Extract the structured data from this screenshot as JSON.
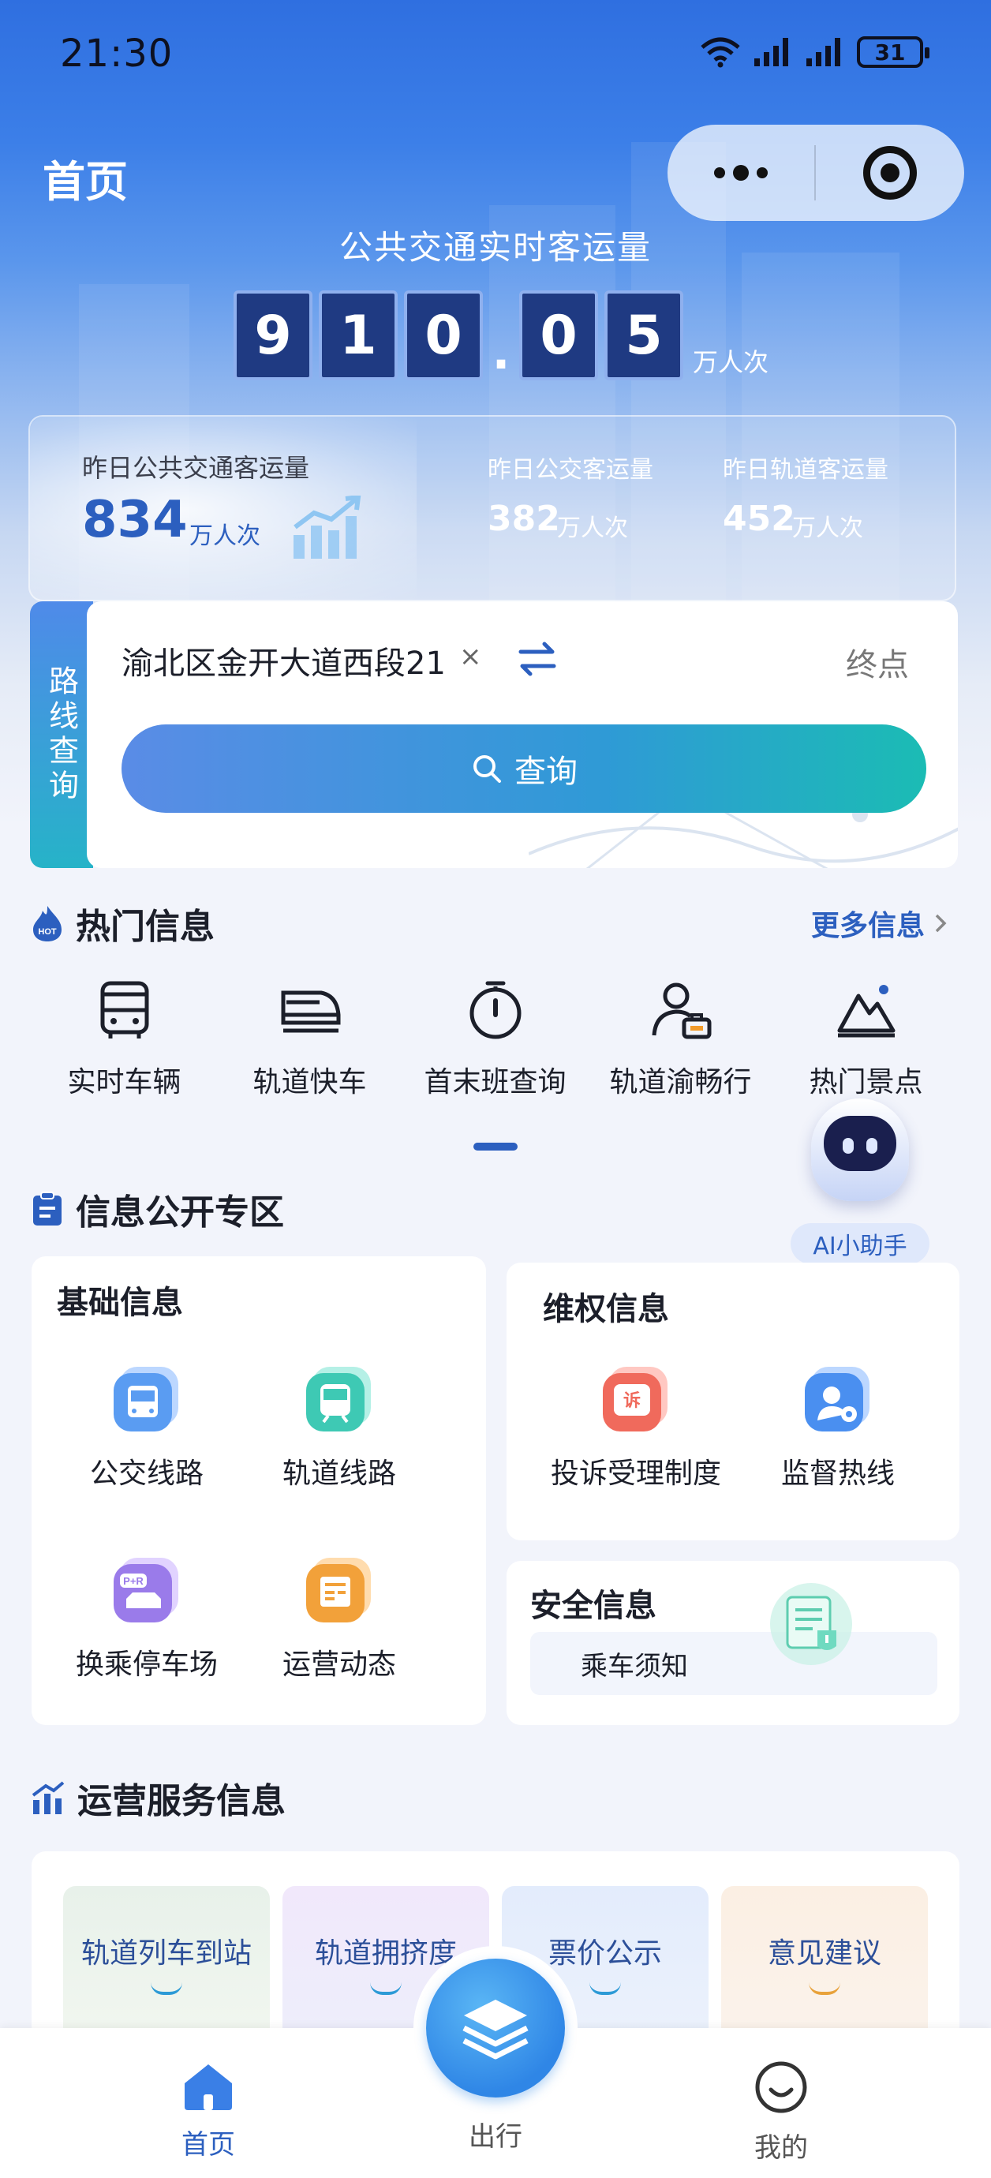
{
  "status_bar": {
    "time": "21:30",
    "battery": "31"
  },
  "header": {
    "title": "首页"
  },
  "realtime": {
    "title": "公共交通实时客运量",
    "digits": [
      "9",
      "1",
      "0",
      ".",
      "0",
      "5"
    ],
    "unit": "万人次"
  },
  "yesterday": {
    "total_label": "昨日公共交通客运量",
    "total_value": "834",
    "total_unit": "万人次",
    "bus_label": "昨日公交客运量",
    "bus_value": "382",
    "bus_unit": "万人次",
    "rail_label": "昨日轨道客运量",
    "rail_value": "452",
    "rail_unit": "万人次"
  },
  "route_search": {
    "tag": "路线查询",
    "from_value": "渝北区金开大道西段21",
    "clear": "×",
    "to_placeholder": "终点",
    "search_label": "查询"
  },
  "hot_info": {
    "title": "热门信息",
    "more": "更多信息",
    "items": [
      {
        "label": "实时车辆",
        "icon": "bus-icon"
      },
      {
        "label": "轨道快车",
        "icon": "train-icon"
      },
      {
        "label": "首末班查询",
        "icon": "timer-icon"
      },
      {
        "label": "轨道渝畅行",
        "icon": "person-ticket-icon"
      },
      {
        "label": "热门景点",
        "icon": "mountain-icon"
      }
    ]
  },
  "ai_assistant": {
    "label": "AI小助手"
  },
  "disclosure": {
    "title": "信息公开专区",
    "basic": {
      "title": "基础信息",
      "items": [
        {
          "label": "公交线路",
          "icon": "bus-route-icon"
        },
        {
          "label": "轨道线路",
          "icon": "rail-route-icon"
        },
        {
          "label": "换乘停车场",
          "icon": "park-ride-icon"
        },
        {
          "label": "运营动态",
          "icon": "news-icon"
        }
      ]
    },
    "rights": {
      "title": "维权信息",
      "items": [
        {
          "label": "投诉受理制度",
          "icon": "complaint-icon"
        },
        {
          "label": "监督热线",
          "icon": "hotline-icon"
        }
      ]
    },
    "safety": {
      "title": "安全信息",
      "notice": "乘车须知"
    }
  },
  "operation": {
    "title": "运营服务信息",
    "items": [
      {
        "label": "轨道列车到站"
      },
      {
        "label": "轨道拥挤度"
      },
      {
        "label": "票价公示"
      },
      {
        "label": "意见建议"
      }
    ]
  },
  "tabbar": {
    "home": "首页",
    "travel": "出行",
    "mine": "我的"
  },
  "colors": {
    "accent": "#2c5fbf",
    "brand_gradient_start": "#5a8ce6",
    "brand_gradient_end": "#1bbcb4"
  }
}
